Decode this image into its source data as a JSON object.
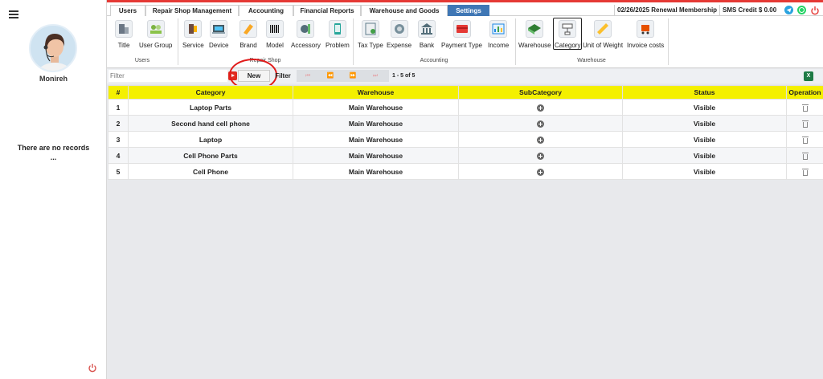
{
  "sidebar": {
    "username": "Monireh",
    "no_records": "There are no records",
    "no_records_ellipsis": "..."
  },
  "topbar": {
    "tabs": [
      "Users",
      "Repair Shop Management",
      "Accounting",
      "Financial Reports",
      "Warehouse and Goods",
      "Settings"
    ],
    "active_tab": "Settings",
    "membership": "02/26/2025 Renewal Membership",
    "sms_credit": "SMS Credit $ 0.00",
    "icons": [
      "telegram-icon",
      "whatsapp-icon",
      "power-icon"
    ]
  },
  "ribbon": {
    "groups": [
      {
        "label": "Users",
        "items": [
          "Title",
          "User Group"
        ]
      },
      {
        "label": "Repair Shop",
        "items": [
          "Service",
          "Device",
          "Brand",
          "Model",
          "Accessory",
          "Problem"
        ]
      },
      {
        "label": "Accounting",
        "items": [
          "Tax Type",
          "Expense",
          "Bank",
          "Payment Type",
          "Income"
        ]
      },
      {
        "label": "Warehouse",
        "items": [
          "Warehouse",
          "Category",
          "Unit of Weight",
          "Invoice costs"
        ]
      }
    ],
    "selected": "Category"
  },
  "filterbar": {
    "filter_placeholder": "Filter",
    "new_label": "New",
    "filter_label": "Filter",
    "page_info": "1 - 5 of 5",
    "pager_icons": [
      "first-page-icon",
      "prev-page-icon",
      "next-page-icon",
      "last-page-icon"
    ]
  },
  "table": {
    "columns": [
      "#",
      "Category",
      "Warehouse",
      "SubCategory",
      "Status",
      "Operation"
    ],
    "rows": [
      {
        "num": "1",
        "category": "Laptop Parts",
        "warehouse": "Main Warehouse",
        "status": "Visible"
      },
      {
        "num": "2",
        "category": "Second hand cell phone",
        "warehouse": "Main Warehouse",
        "status": "Visible"
      },
      {
        "num": "3",
        "category": "Laptop",
        "warehouse": "Main Warehouse",
        "status": "Visible"
      },
      {
        "num": "4",
        "category": "Cell Phone Parts",
        "warehouse": "Main Warehouse",
        "status": "Visible"
      },
      {
        "num": "5",
        "category": "Cell Phone",
        "warehouse": "Main Warehouse",
        "status": "Visible"
      }
    ]
  },
  "colors": {
    "accent_red": "#e53935",
    "active_tab": "#3f77b5",
    "header_yellow": "#f4f000",
    "telegram": "#2aa3df",
    "whatsapp": "#25d366"
  }
}
